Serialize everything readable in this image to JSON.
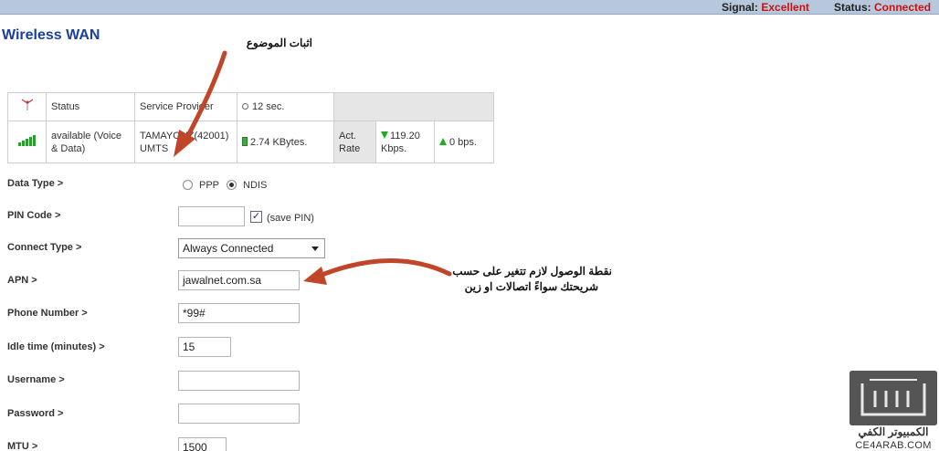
{
  "header": {
    "signal_label": "Signal:",
    "signal_value": "Excellent",
    "status_label": "Status:",
    "status_value": "Connected"
  },
  "page": {
    "title": "Wireless WAN"
  },
  "status_table": {
    "status_header": "Status",
    "provider_header": "Service Provider",
    "time": "12 sec.",
    "status_value": "available (Voice & Data)",
    "provider_line1": "TAMAYOUZ(42001)",
    "provider_line2": "UMTS",
    "data_total": "2.74 KBytes.",
    "act_rate_label": "Act. Rate",
    "download_rate": "119.20 Kbps.",
    "upload_rate": "0 bps."
  },
  "form": {
    "data_type_label": "Data Type >",
    "data_type_options": [
      "PPP",
      "NDIS"
    ],
    "data_type_selected": "NDIS",
    "pin_code_label": "PIN Code >",
    "pin_code_value": "",
    "save_pin_label": "(save PIN)",
    "save_pin_checked": true,
    "connect_type_label": "Connect Type >",
    "connect_type_value": "Always Connected",
    "apn_label": "APN >",
    "apn_value": "jawalnet.com.sa",
    "phone_label": "Phone Number >",
    "phone_value": "*99#",
    "idle_label": "Idle time (minutes) >",
    "idle_value": "15",
    "username_label": "Username >",
    "username_value": "",
    "password_label": "Password >",
    "password_value": "",
    "mtu_label": "MTU >",
    "mtu_value": "1500"
  },
  "annotations": {
    "top": "اثبات الموضوع",
    "apn_line1": "نقطة الوصول لازم تتغير على حسب",
    "apn_line2": "شريحتك سواءً اتصالات او زين"
  },
  "watermark": {
    "arabic": "الكمبيوتر الكفي",
    "english": "CE4ARAB.COM"
  },
  "colors": {
    "title": "#1a3fa0",
    "status_red": "#cc1111",
    "topbar": "#b7c8dd",
    "annotation_arrow": "#c0462a"
  },
  "icons": [
    "antenna-icon",
    "signal-bars-icon",
    "clock-icon",
    "battery-icon",
    "download-arrow-icon",
    "upload-arrow-icon",
    "dropdown-caret-icon"
  ]
}
